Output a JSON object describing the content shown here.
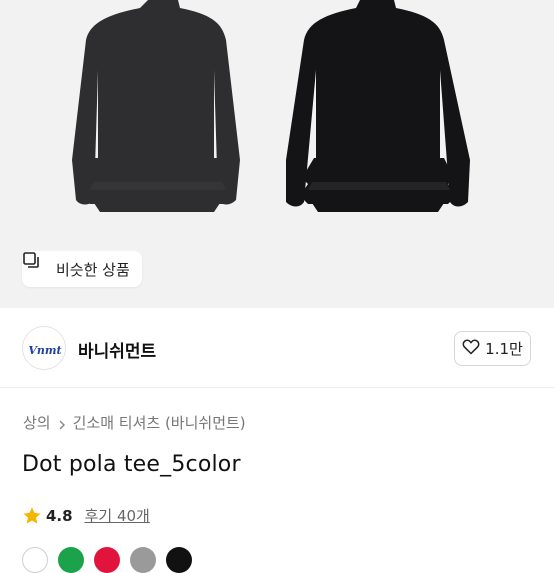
{
  "hero": {
    "similar_label": "비슷한 상품"
  },
  "shop": {
    "name": "바니쉬먼트",
    "logo_text": "Vnmt",
    "follow_count": "1.1만"
  },
  "breadcrumb": {
    "items": [
      "상의",
      "긴소매 티셔츠 (바니쉬먼트)"
    ]
  },
  "product": {
    "title": "Dot pola tee_5color",
    "rating": "4.8",
    "reviews_label": "후기 40개"
  },
  "colors": {
    "accent_star": "#f5b400",
    "logo_blue": "#1f3fa8",
    "swatches": [
      "#ffffff",
      "#1aa34a",
      "#e0143c",
      "#9a9a9a",
      "#111111"
    ]
  },
  "icons": [
    "similar-items-icon",
    "heart-icon",
    "chevron-right-icon",
    "star-icon"
  ]
}
